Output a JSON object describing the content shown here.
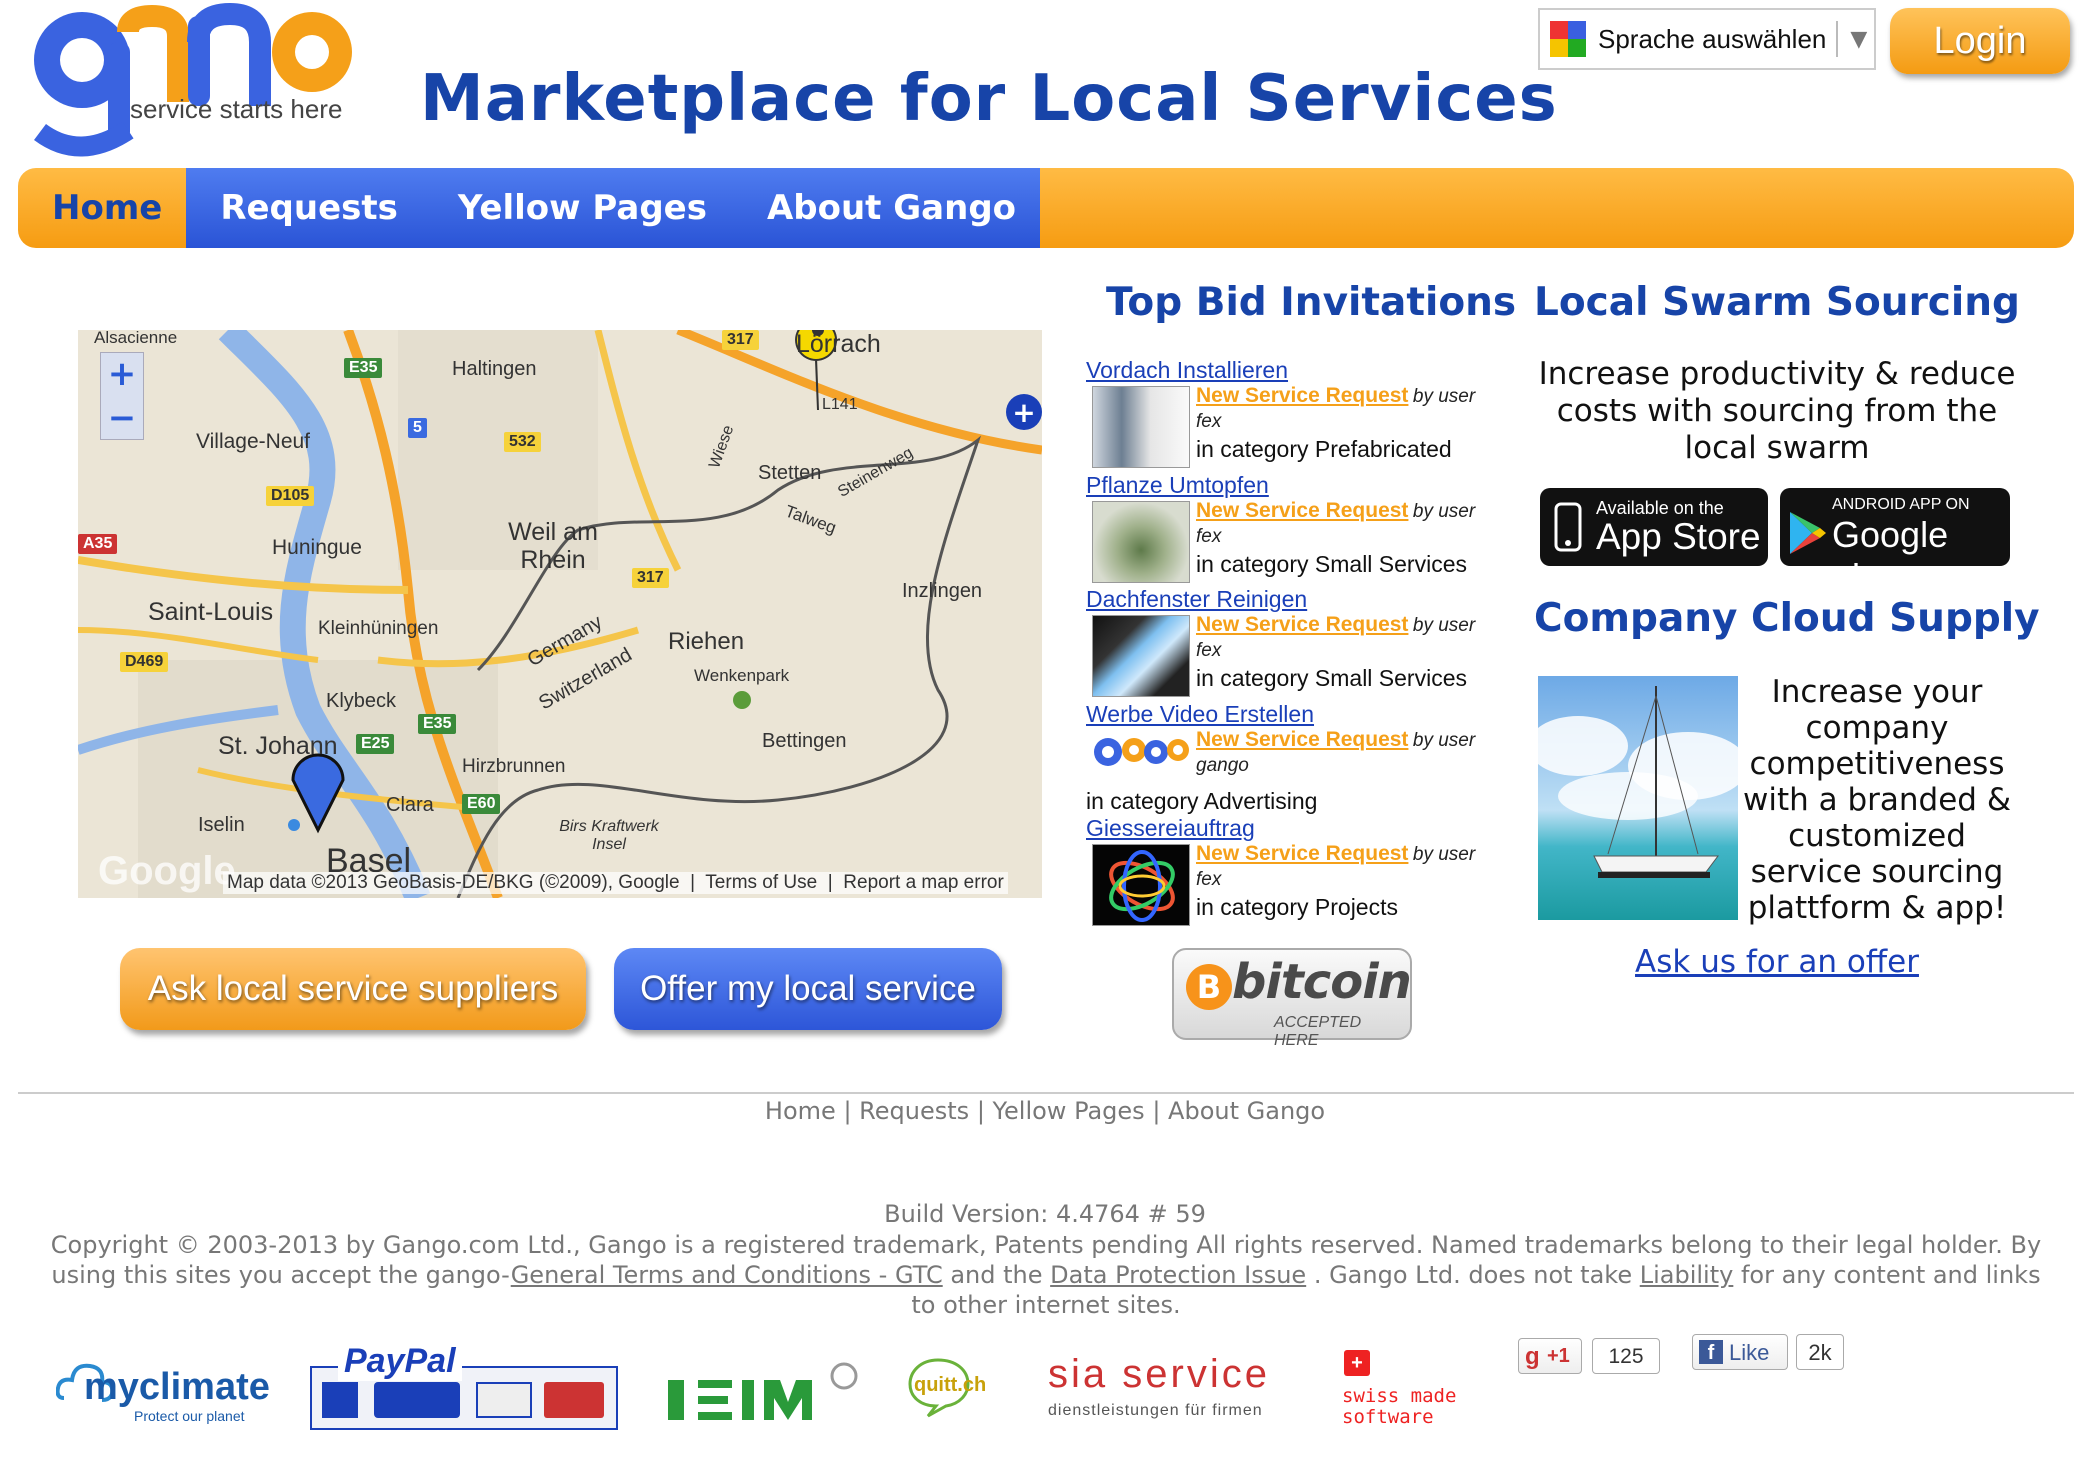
{
  "header": {
    "logo_tagline": "service starts here",
    "title": "Marketplace for Local Services",
    "language_select": "Sprache auswählen",
    "login_label": "Login"
  },
  "nav": {
    "items": [
      {
        "label": "Home"
      },
      {
        "label": "Requests"
      },
      {
        "label": "Yellow Pages"
      },
      {
        "label": "About Gango"
      }
    ]
  },
  "map": {
    "labels": [
      "Alsacienne",
      "Haltingen",
      "Lörrach",
      "Village-Neuf",
      "Huningue",
      "Saint-Louis",
      "Kleinhüningen",
      "Weil am Rhein",
      "Stetten",
      "Inzlingen",
      "Riehen",
      "Wenkenpark",
      "Bettingen",
      "Klybeck",
      "St. Johann",
      "Hirzbrunnen",
      "Clara",
      "Iselin",
      "Basel",
      "Germany",
      "Switzerland",
      "Birs Kraftwerk Insel",
      "Talweg",
      "Steinenweg",
      "Wiese",
      "L141"
    ],
    "roads": [
      "E35",
      "5",
      "532",
      "D105",
      "A35",
      "317",
      "D469",
      "E25",
      "E35",
      "E60",
      "317"
    ],
    "attribution": "Map data ©2013 GeoBasis-DE/BKG (©2009), Google",
    "terms": "Terms of Use",
    "report": "Report a map error",
    "watermark": "Google",
    "zoom_in": "+",
    "zoom_out": "−"
  },
  "actions": {
    "ask_label": "Ask local service suppliers",
    "offer_label": "Offer my local service"
  },
  "bids": {
    "heading": "Top Bid Invitations",
    "new_label": "New Service Request",
    "by_user": "by user",
    "items": [
      {
        "title": "Vordach Installieren",
        "user": "fex",
        "category": "in category Prefabricated"
      },
      {
        "title": "Pflanze Umtopfen",
        "user": "fex",
        "category": "in category Small Services"
      },
      {
        "title": "Dachfenster Reinigen",
        "user": "fex",
        "category": "in category Small Services"
      },
      {
        "title": "Werbe Video Erstellen",
        "user": "gango",
        "category": "in category Advertising"
      },
      {
        "title": "Giessereiauftrag",
        "user": "fex",
        "category": "in category Projects"
      }
    ],
    "bitcoin_word": "bitcoin",
    "bitcoin_sub": "ACCEPTED HERE"
  },
  "swarm": {
    "heading": "Local Swarm Sourcing",
    "text": "Increase productivity & reduce costs with sourcing from the local swarm",
    "appstore_small": "Available on the",
    "appstore_big": "App Store",
    "googleplay_small": "ANDROID APP ON",
    "googleplay_big": "Google play"
  },
  "cloud": {
    "heading": "Company Cloud Supply",
    "text": "Increase your company competitiveness with a branded & customized service sourcing plattform & app!",
    "offer_link": "Ask us for an offer"
  },
  "footer": {
    "nav": [
      "Home",
      "Requests",
      "Yellow Pages",
      "About Gango"
    ],
    "separator": "|",
    "build": "Build Version: 4.4764 # 59",
    "copyright_1": "Copyright © 2003-2013 by Gango.com Ltd., Gango is a registered trademark, Patents pending All rights reserved. Named trademarks belong to their legal holder. By using this sites you accept the gango-",
    "gtc_link": "General Terms and Conditions - GTC",
    "copyright_2": " and the ",
    "privacy_link": "Data Protection Issue",
    "copyright_3": " . Gango Ltd. does not take ",
    "liability_link": "Liability",
    "copyright_4": " for any content and links to other internet sites.",
    "partners": {
      "myclimate": "myclimate",
      "myclimate_sub": "Protect our planet",
      "paypal": "PayPal",
      "ibm": "I-B-M",
      "quitt": "quitt.ch",
      "sia": "sia service",
      "sia_sub": "dienstleistungen für firmen",
      "swiss": "swiss made software"
    },
    "gplus_label": "+1",
    "gplus_count": "125",
    "like_label": "Like",
    "like_count": "2k"
  },
  "colors": {
    "brand_blue": "#1744a8",
    "nav_orange": "#f69c12",
    "nav_blue": "#2a54d6",
    "link_orange": "#f5a019"
  }
}
